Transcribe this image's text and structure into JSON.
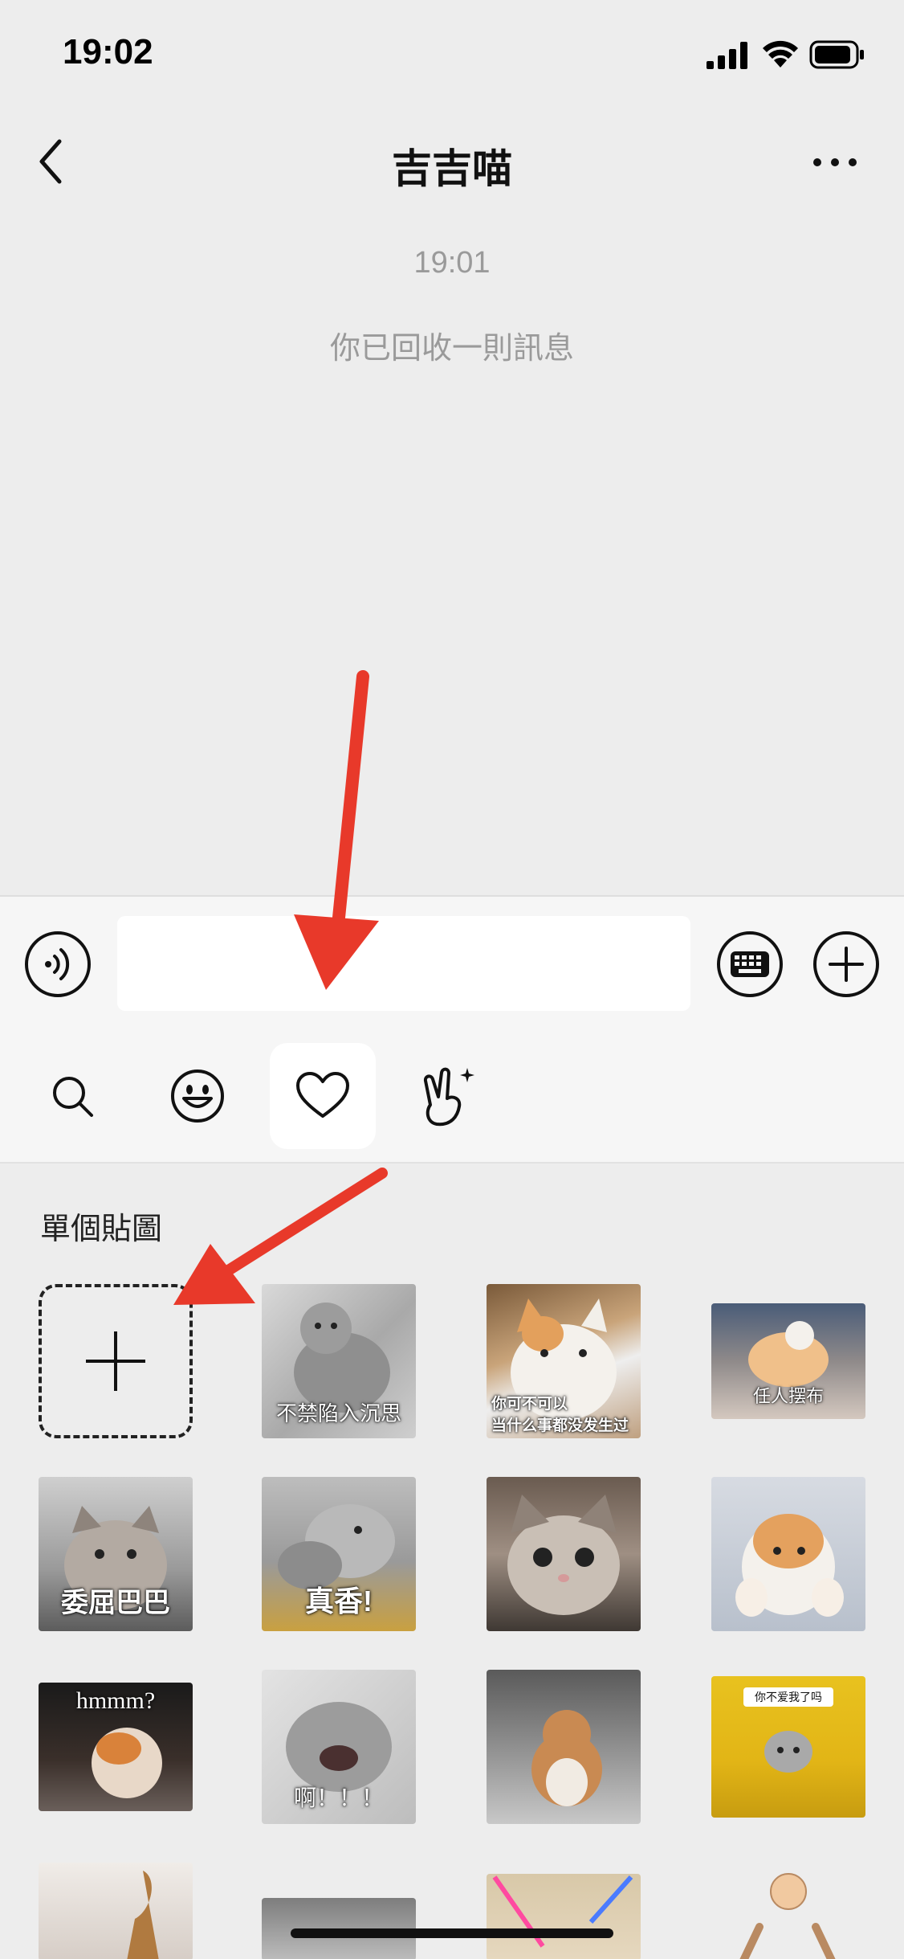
{
  "status_bar": {
    "time": "19:02",
    "icons": [
      "signal-icon",
      "wifi-icon",
      "battery-icon"
    ]
  },
  "nav": {
    "title": "吉吉喵",
    "back_icon": "chevron-left-icon",
    "more_icon": "more-dots-icon"
  },
  "messages": {
    "timestamp": "19:01",
    "system_text": "你已回收一則訊息"
  },
  "input": {
    "value": "",
    "placeholder": "",
    "voice_icon": "voice-icon",
    "keyboard_icon": "keyboard-icon",
    "plus_icon": "plus-circle-icon"
  },
  "emoji_tabs": [
    {
      "icon": "search-icon",
      "active": false
    },
    {
      "icon": "emoji-face-icon",
      "active": false
    },
    {
      "icon": "heart-icon",
      "active": true
    },
    {
      "icon": "sticker-gesture-icon",
      "active": false
    }
  ],
  "sticker_panel": {
    "section_title": "單個貼圖",
    "add_icon": "plus-icon",
    "stickers": [
      {
        "caption": "不禁陷入沉思"
      },
      {
        "caption": "你可不可以\n当什么事都没发生过"
      },
      {
        "caption": "任人摆布"
      },
      {
        "caption": "委屈巴巴"
      },
      {
        "caption": "真香!"
      },
      {
        "caption": ""
      },
      {
        "caption": ""
      },
      {
        "caption": "hmmm?"
      },
      {
        "caption": "啊！！！"
      },
      {
        "caption": ""
      },
      {
        "caption": "你不爱我了吗"
      }
    ]
  },
  "colors": {
    "accent_arrow": "#e8392a",
    "background": "#ededed",
    "input_area": "#f6f6f6",
    "muted_text": "#9a9a9a"
  }
}
